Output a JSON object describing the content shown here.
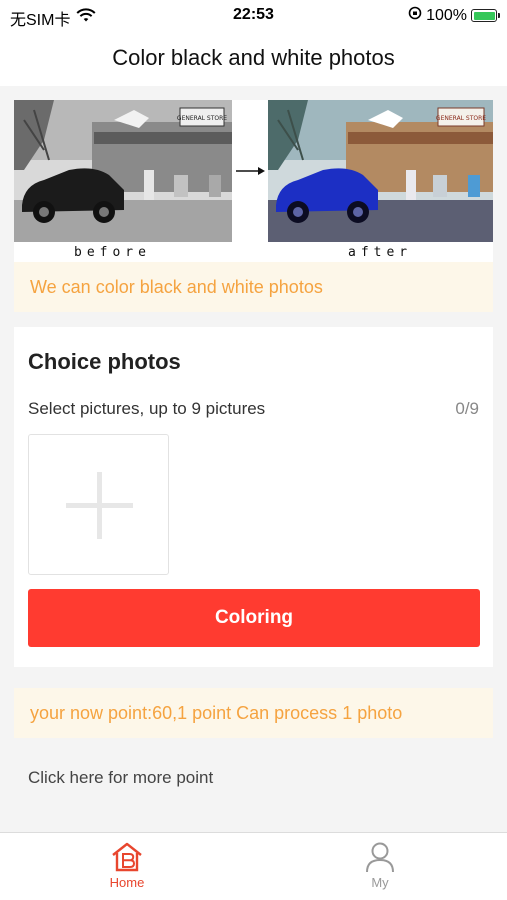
{
  "status_bar": {
    "carrier": "无SIM卡",
    "time": "22:53",
    "battery": "100%",
    "icons": [
      "wifi-icon",
      "orientation-lock-icon",
      "battery-charging-icon"
    ]
  },
  "nav": {
    "title": "Color black and white photos"
  },
  "compare": {
    "before_label": "before",
    "after_label": "after",
    "sign_text": "GENERAL STORE"
  },
  "notice": {
    "text": "We can color black and white photos"
  },
  "picker": {
    "title": "Choice photos",
    "subtitle": "Select pictures, up to 9 pictures",
    "count": "0/9",
    "add_icon": "plus-icon",
    "button_label": "Coloring"
  },
  "points": {
    "text": "your now point:60,1 point Can process 1 photo",
    "more_link": "Click here for more point"
  },
  "tabs": [
    {
      "label": "Home",
      "icon": "home-icon",
      "active": true
    },
    {
      "label": "My",
      "icon": "user-icon",
      "active": false
    }
  ],
  "colors": {
    "accent": "#ff3b30",
    "notice_text": "#f5a340",
    "notice_bg": "#fdf7e9",
    "tab_active": "#e8462e",
    "tab_inactive": "#999999"
  }
}
